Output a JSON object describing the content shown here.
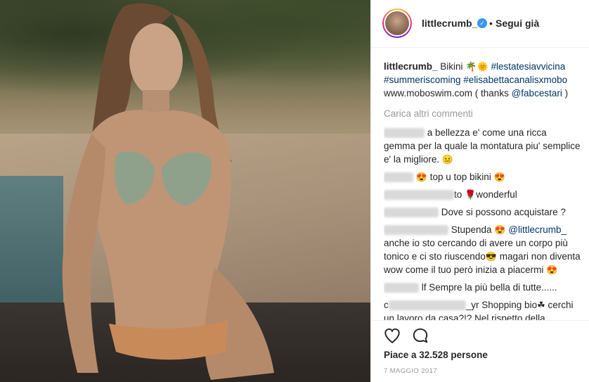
{
  "header": {
    "username": "littlecrumb_",
    "dot": "•",
    "follow_label": "Segui già"
  },
  "caption": {
    "username": "littlecrumb_",
    "text": "Bikini",
    "emojis": "🌴🌞",
    "hashtags": [
      "#lestatesiavvicina",
      "#summeriscoming",
      "#elisabettacanalisxmobo"
    ],
    "site": "www.moboswim.com",
    "thanks_prefix": "( thanks",
    "mention": "@fabcestari",
    "thanks_suffix": ")"
  },
  "load_more": "Carica altri commenti",
  "comments": [
    {
      "text": "a bellezza e' come una ricca gemma per la quale la montatura piu' semplice e' la migliore.",
      "emoji": "😐"
    },
    {
      "text": "top u top bikini",
      "emoji_before": "😍",
      "emoji_after": "😍"
    },
    {
      "mid": "to",
      "emoji": "🌹",
      "text": "wonderful"
    },
    {
      "text": "Dove si possono acquistare ?"
    },
    {
      "text": "Stupenda",
      "emoji": "😍",
      "mention": "@littlecrumb_",
      "text2": "anche io sto cercando di avere un corpo più tonico e ci sto riuscendo",
      "emoji2": "😎",
      "text3": "magari non diventa wow come il tuo però inizia a piacermi",
      "emoji3": "😍"
    },
    {
      "text": "lf Sempre la più bella di tutte......"
    },
    {
      "prefix": "c",
      "suffix": "_yr Shopping bio",
      "emoji": "☘",
      "text": "cerchi un lavoro da casa?!? Nel rispetto della"
    }
  ],
  "likes": "Piace a 32.528 persone",
  "date": "7 MAGGIO 2017",
  "icons": {
    "heart": "heart-icon",
    "comment": "comment-icon",
    "verified": "verified-badge-icon"
  },
  "colors": {
    "link": "#003569",
    "verified": "#3897f0",
    "muted": "#999999",
    "text": "#262626"
  }
}
